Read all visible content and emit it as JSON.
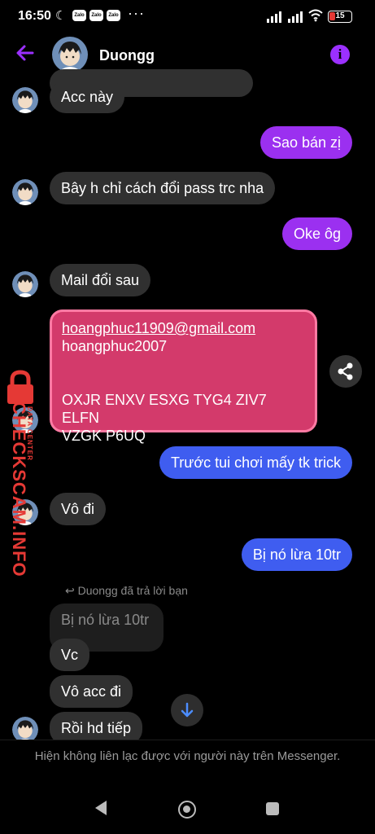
{
  "status_bar": {
    "time": "16:50",
    "notification_apps": [
      "Zalo",
      "Zalo",
      "Zalo"
    ],
    "overflow": "···",
    "battery": "15",
    "icons": [
      "moon-icon",
      "signal-icon",
      "wifi-icon",
      "battery-icon"
    ]
  },
  "header": {
    "contact_name": "Duongg",
    "back_icon": "arrow-left-icon",
    "info_icon": "info-icon"
  },
  "messages": {
    "m1": "Acc này",
    "m2": "Sao bán zị",
    "m3": "Bây h chỉ cách đổi pass trc nha",
    "m4": "Oke ôg",
    "m5": "Mail đổi sau",
    "card": {
      "email": "hoangphuc11909@gmail.com",
      "password": "hoangphuc2007",
      "code_line1": "OXJR ENXV ESXG TYG4 ZIV7 ELFN",
      "code_line2": "VZGK P6UQ"
    },
    "m6": "Trước tui chơi mấy tk trick",
    "m7": "Vô đi",
    "m8": "Bị nó lừa 10tr",
    "reply_hint": "Duongg đã trả lời bạn",
    "quoted": "Bị nó lừa 10tr",
    "m9": "Vc",
    "m10": "Vô acc đi",
    "m11": "Rồi hd tiếp"
  },
  "footer": {
    "notice": "Hiện không liên lạc được với người này trên Messenger."
  },
  "watermark": {
    "text": "CHECKSCAM.INFO",
    "sub": "DATA CENTER"
  },
  "colors": {
    "accent_purple": "#9b30f0",
    "outgoing_blue": "#3f5df0",
    "incoming_gray": "#303030",
    "card_pink": "#d33a6b",
    "watermark_red": "#e53935"
  }
}
